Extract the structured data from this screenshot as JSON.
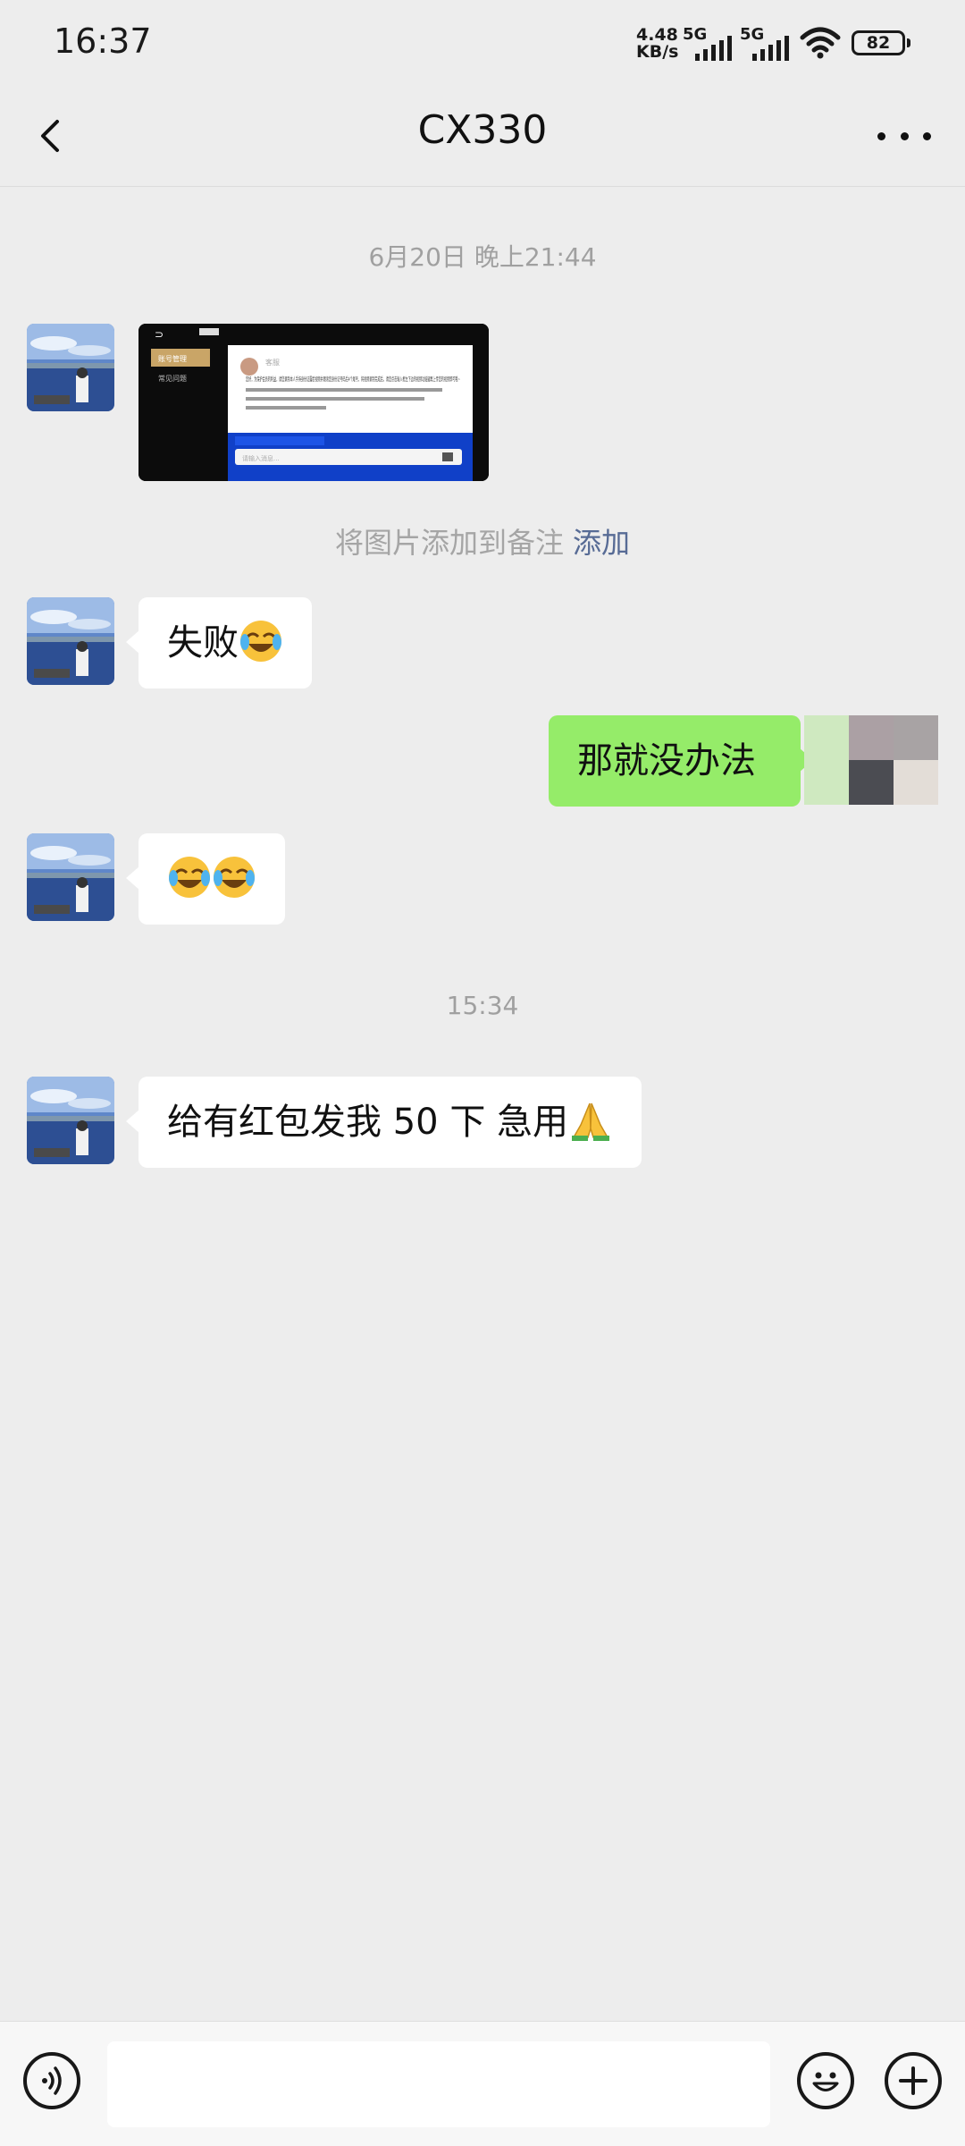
{
  "status": {
    "time": "16:37",
    "net_speed_value": "4.48",
    "net_speed_unit": "KB/s",
    "sim1": "5G",
    "sim2": "5G",
    "battery": "82"
  },
  "header": {
    "title": "CX330",
    "back_icon": "chevron-left-icon",
    "more_icon": "more-dots-icon"
  },
  "messages": {
    "timestamp1": "6月20日 晚上21:44",
    "image_hint": "将图片添加到备注",
    "image_hint_action": "添加",
    "msg_fail": "失败",
    "msg_reply": "那就没办法",
    "timestamp2": "15:34",
    "msg_money": "给有红包发我 50 下 急用"
  },
  "screenshot_thumb": {
    "menu1": "账号管理",
    "menu2": "常见问题",
    "sender": "客服",
    "text": "您好，为保护会员的利益，请您录制本人手持身份证露脸视频并朗读您身份证号码后4个尾号，将视频录制完成后，请您点击输入框左下边的视频功能键再上传您的视频即可哦~",
    "placeholder": "请输入消息..."
  },
  "input": {
    "voice_icon": "voice-icon",
    "emoji_icon": "emoji-icon",
    "plus_icon": "plus-icon"
  },
  "colors": {
    "background": "#ededed",
    "bubble_self": "#95ec69",
    "bubble_other": "#ffffff",
    "link": "#576b95"
  }
}
